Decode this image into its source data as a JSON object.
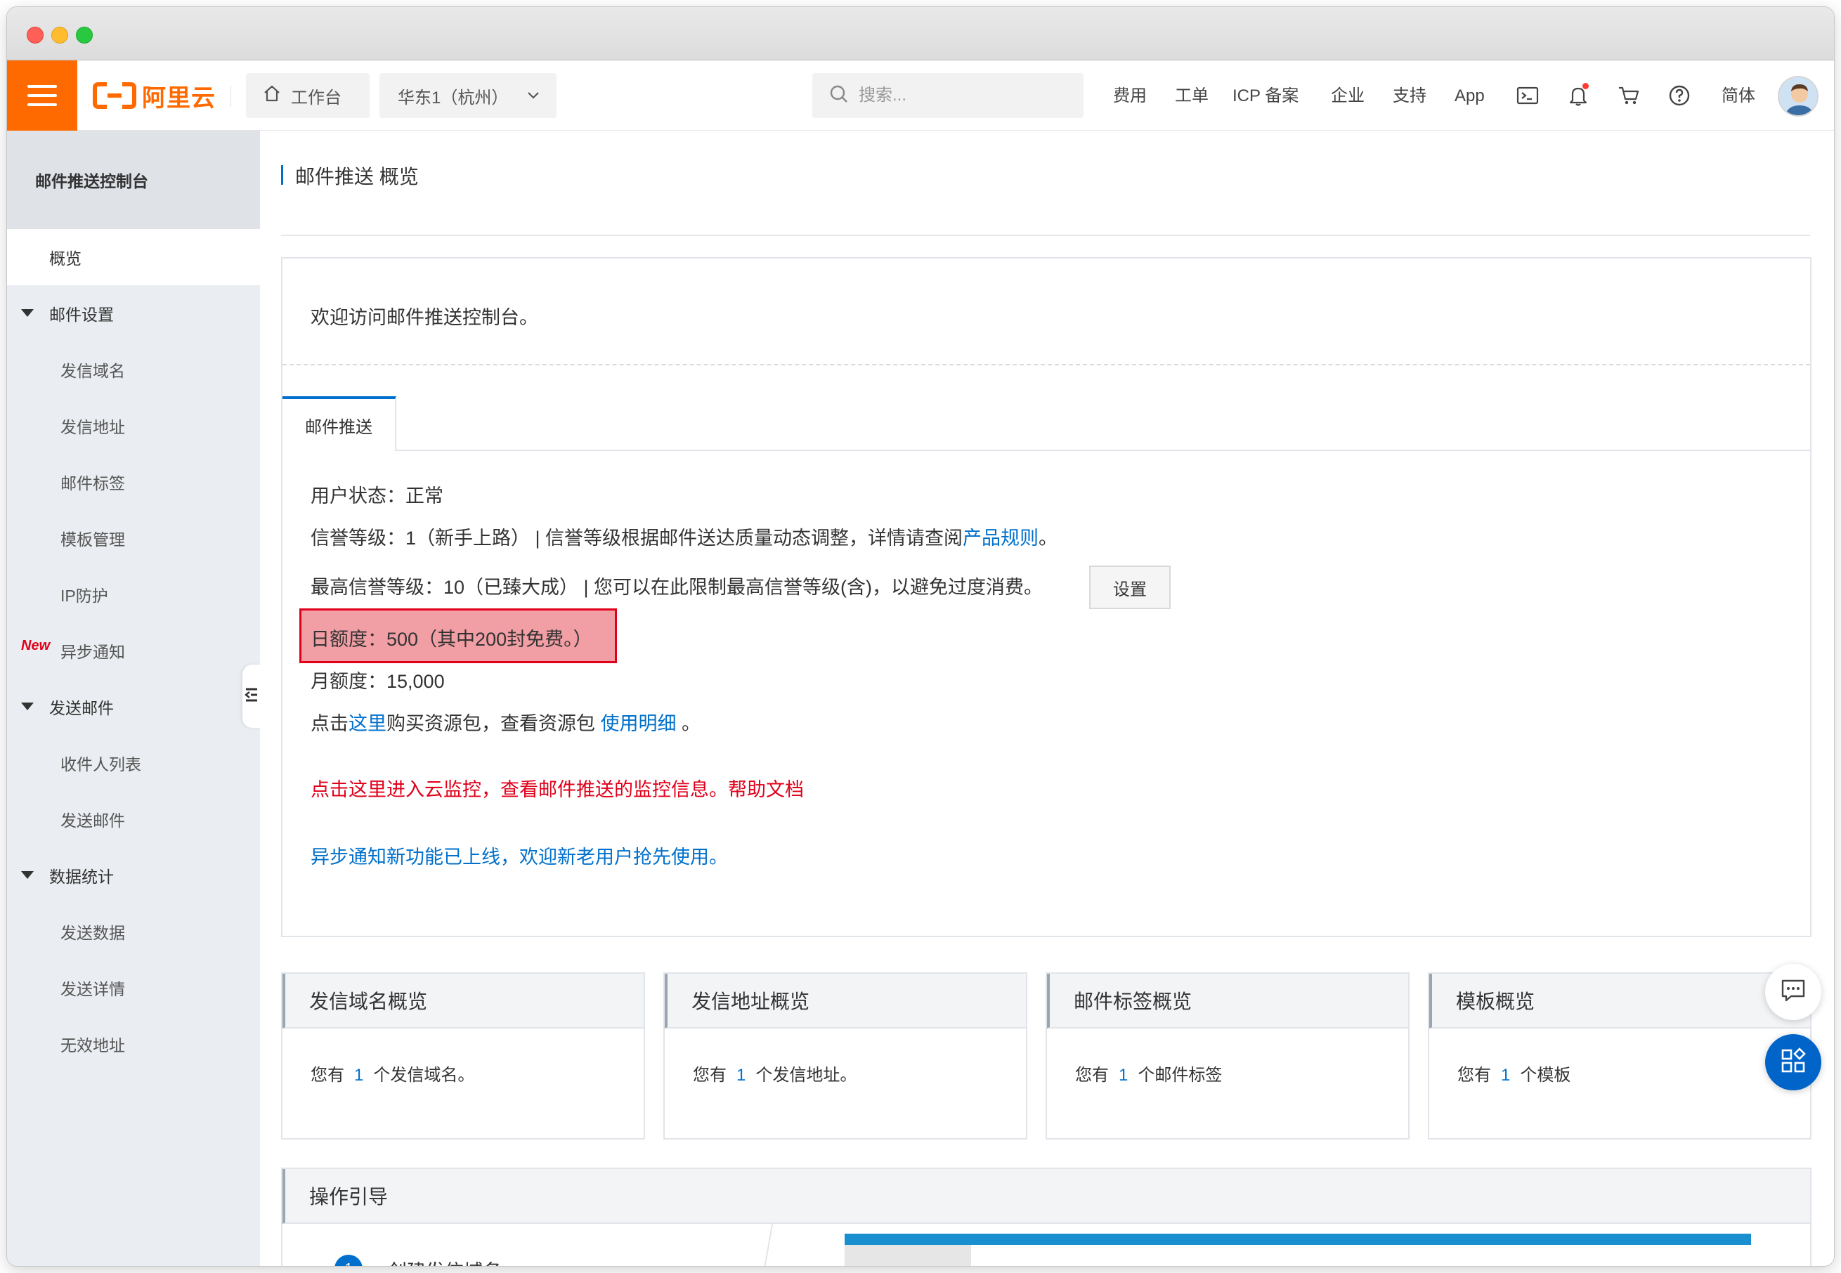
{
  "topnav": {
    "logo_text": "阿里云",
    "workbench": "工作台",
    "region": "华东1（杭州）",
    "search_placeholder": "搜索...",
    "links": [
      "费用",
      "工单",
      "ICP 备案",
      "企业",
      "支持",
      "App"
    ],
    "language": "简体",
    "brand_color": "#ff6a00"
  },
  "sidebar": {
    "title": "邮件推送控制台",
    "overview": "概览",
    "groups": [
      {
        "label": "邮件设置",
        "items": [
          "发信域名",
          "发信地址",
          "邮件标签",
          "模板管理",
          "IP防护",
          "异步通知"
        ]
      },
      {
        "label": "发送邮件",
        "items": [
          "收件人列表",
          "发送邮件"
        ]
      },
      {
        "label": "数据统计",
        "items": [
          "发送数据",
          "发送详情",
          "无效地址"
        ]
      }
    ],
    "new_badge": "New"
  },
  "page": {
    "title": "邮件推送 概览",
    "welcome": "欢迎访问邮件推送控制台。",
    "tab": "邮件推送",
    "user_status": "用户状态：正常",
    "credit_level_prefix": "信誉等级：1（新手上路） | 信誉等级根据邮件送达质量动态调整，详情请查阅",
    "credit_level_link": "产品规则",
    "credit_level_suffix": "。",
    "max_credit": "最高信誉等级：10（已臻大成） | 您可以在此限制最高信誉等级(含)，以避免过度消费。",
    "set_button": "设置",
    "daily_quota": "日额度：500（其中200封免费。）",
    "monthly_quota": "月额度：15,000",
    "buy_prefix": "点击",
    "buy_link": "这里",
    "buy_middle": "购买资源包，查看资源包 ",
    "usage_link": "使用明细",
    "buy_suffix": " 。",
    "monitor_notice": "点击这里进入云监控，查看邮件推送的监控信息。帮助文档",
    "async_notice": "异步通知新功能已上线，欢迎新老用户抢先使用。"
  },
  "cards": [
    {
      "title": "发信域名概览",
      "prefix": "您有",
      "count": "1",
      "suffix": "个发信域名。"
    },
    {
      "title": "发信地址概览",
      "prefix": "您有",
      "count": "1",
      "suffix": "个发信地址。"
    },
    {
      "title": "邮件标签概览",
      "prefix": "您有",
      "count": "1",
      "suffix": "个邮件标签"
    },
    {
      "title": "模板概览",
      "prefix": "您有",
      "count": "1",
      "suffix": "个模板"
    }
  ],
  "guide": {
    "title": "操作引导",
    "step_number": "1",
    "step_text": "创建发信域名"
  },
  "colors": {
    "accent": "#0070cc",
    "alert_red": "#e0001a",
    "highlight_fill": "#f19ea4"
  }
}
